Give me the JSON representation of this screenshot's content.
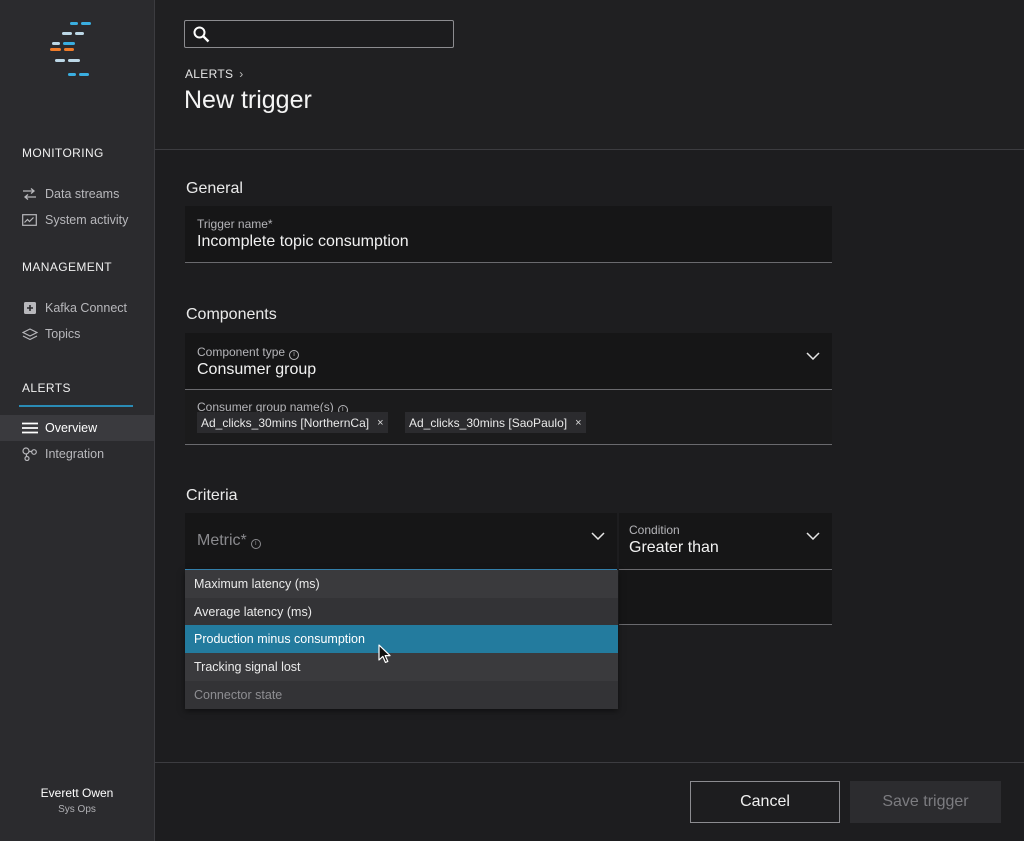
{
  "sidebar": {
    "monitoring_title": "MONITORING",
    "monitoring_items": [
      {
        "label": "Data streams",
        "icon": "arrows-icon"
      },
      {
        "label": "System activity",
        "icon": "activity-chart-icon"
      }
    ],
    "management_title": "MANAGEMENT",
    "management_items": [
      {
        "label": "Kafka Connect",
        "icon": "connector-icon"
      },
      {
        "label": "Topics",
        "icon": "layers-icon"
      }
    ],
    "alerts_title": "ALERTS",
    "alerts_items": [
      {
        "label": "Overview",
        "icon": "menu-lines-icon",
        "active": true
      },
      {
        "label": "Integration",
        "icon": "nodes-icon",
        "active": false
      }
    ],
    "user": {
      "name": "Everett Owen",
      "role": "Sys Ops"
    },
    "logo_colors": {
      "blue": "#3aaee0",
      "light": "#bcd7e6",
      "orange": "#f07c2a"
    }
  },
  "header": {
    "search": {
      "placeholder": "",
      "value": ""
    },
    "breadcrumb": "ALERTS",
    "title": "New trigger"
  },
  "general": {
    "heading": "General",
    "trigger_name_label": "Trigger name*",
    "trigger_name_value": "Incomplete topic consumption"
  },
  "components": {
    "heading": "Components",
    "component_type_label": "Component type",
    "component_type_value": "Consumer group",
    "group_names_label": "Consumer group name(s)",
    "tags": [
      "Ad_clicks_30mins [NorthernCa]",
      "Ad_clicks_30mins [SaoPaulo]"
    ]
  },
  "criteria": {
    "heading": "Criteria",
    "metric_placeholder": "Metric*",
    "condition_label": "Condition",
    "condition_value": "Greater than",
    "metric_options": [
      {
        "label": "Maximum latency (ms)",
        "state": "normal"
      },
      {
        "label": "Average latency (ms)",
        "state": "normal"
      },
      {
        "label": "Production minus consumption",
        "state": "highlighted"
      },
      {
        "label": "Tracking signal lost",
        "state": "normal"
      },
      {
        "label": "Connector state",
        "state": "disabled"
      }
    ]
  },
  "footer": {
    "cancel_label": "Cancel",
    "save_label": "Save trigger"
  },
  "colors": {
    "accent": "#237b9e",
    "focus_underline": "#3a8fc0",
    "background": "#1d1d1f",
    "sidebar": "#2b2b2e",
    "field": "#161617"
  }
}
